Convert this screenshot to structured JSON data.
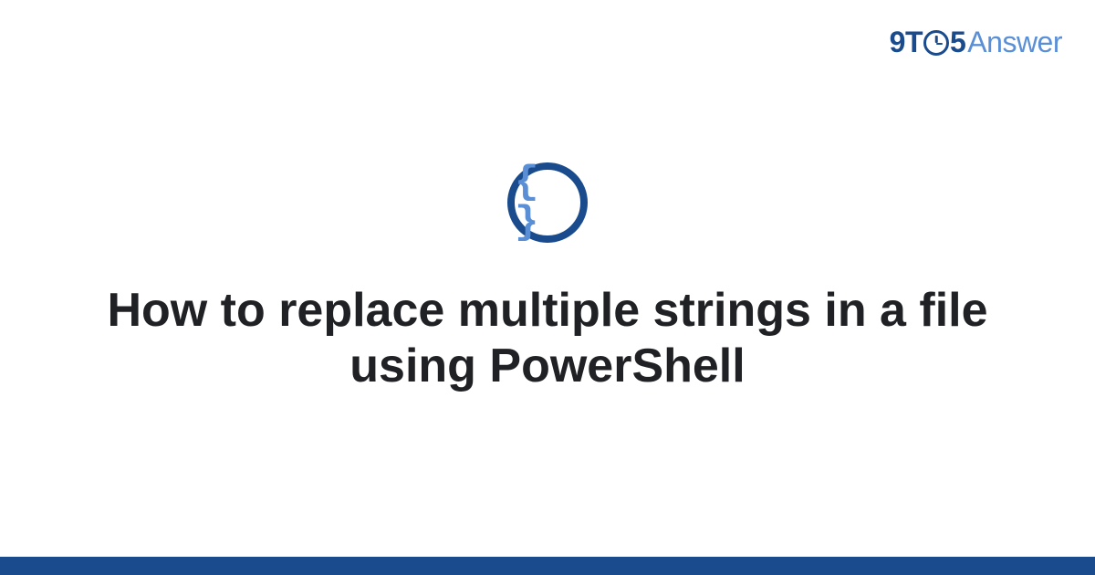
{
  "brand": {
    "part1": "9T",
    "part2": "5",
    "part3": "Answer"
  },
  "icon": {
    "glyph": "{ }"
  },
  "title": "How to replace multiple strings in a file using PowerShell",
  "colors": {
    "primary": "#1a4b8c",
    "accent": "#5a8fd6"
  }
}
